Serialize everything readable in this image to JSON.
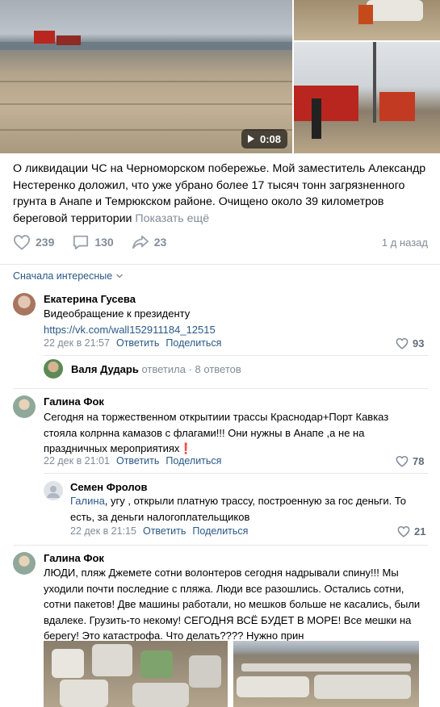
{
  "media": {
    "video_duration": "0:08",
    "icons": {
      "play": "play-icon"
    }
  },
  "post": {
    "text": "О ликвидации ЧС на Черноморском побережье. Мой заместитель Александр Нестеренко доложил, что уже убрано более 17 тысяч тонн загрязненного грунта в Анапе и Темрюкском районе. Очищено около 39 километров береговой территории",
    "show_more": "Показать ещё",
    "likes": "239",
    "comments": "130",
    "shares": "23",
    "time": "1 д назад"
  },
  "sort_label": "Сначала интересные",
  "comments": [
    {
      "author": "Екатерина Гусева",
      "text": "Видеобращение к президенту",
      "link": "https://vk.com/wall152911184_12515",
      "date": "22 дек в 21:57",
      "reply": "Ответить",
      "share": "Поделиться",
      "likes": "93",
      "replies_summary": {
        "author": "Валя Дударь",
        "verb": "ответила",
        "dot": "·",
        "count": "8 ответов"
      }
    },
    {
      "author": "Галина Фок",
      "text": "Сегодня на торжественном открытиии трассы Краснодар+Порт Кавказ стояла колрнна камазов с флагами!!! Они нужны в Анапе ,а не на праздничных мероприятиях",
      "emoji": "❗",
      "date": "22 дек в 21:01",
      "reply": "Ответить",
      "share": "Поделиться",
      "likes": "78",
      "sub": {
        "author": "Семен Фролов",
        "addressee": "Галина",
        "text": ", угу , открыли платную трассу, построенную за гос деньги. То есть, за деньги налогоплательщиков",
        "date": "22 дек в 21:15",
        "reply": "Ответить",
        "share": "Поделиться",
        "likes": "21"
      }
    },
    {
      "author": "Галина Фок",
      "text": "ЛЮДИ, пляж Джемете сотни волонтеров сегодня надрывали спину!!! Мы уходили почти последние с пляжа. Люди все разошлись. Остались сотни, сотни пакетов! Две машины работали, но мешков больше не касались, были вдалеке. Грузить-то некому! СЕГОДНЯ ВСЁ БУДЕТ В МОРЕ! Все мешки на берегу! Это катастрофа. Что делать???? Нужно прин"
    }
  ]
}
